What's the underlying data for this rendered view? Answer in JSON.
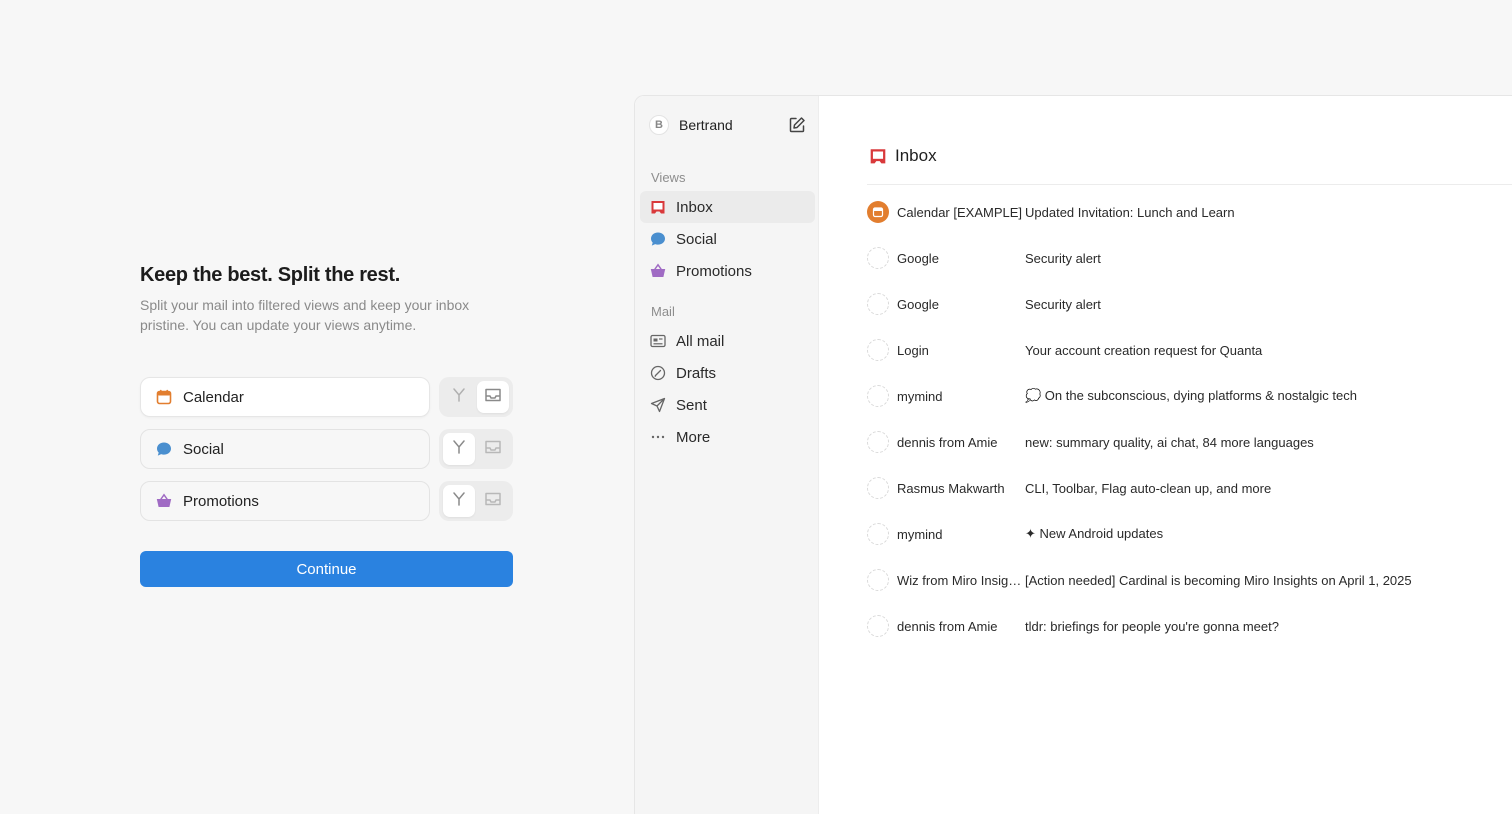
{
  "onboarding": {
    "title": "Keep the best. Split the rest.",
    "subtitle": "Split your mail into filtered views and keep your inbox pristine. You can update your views anytime.",
    "views": [
      {
        "label": "Calendar",
        "icon": "calendar-icon",
        "color": "#e27e2f",
        "mode": "inbox"
      },
      {
        "label": "Social",
        "icon": "chat-bubble-icon",
        "color": "#4a8fcf",
        "mode": "split"
      },
      {
        "label": "Promotions",
        "icon": "basket-icon",
        "color": "#a06bc4",
        "mode": "split"
      }
    ],
    "continue_label": "Continue",
    "accent": "#2a82e0"
  },
  "sidebar": {
    "user_initial": "B",
    "user_name": "Bertrand",
    "views_label": "Views",
    "mail_label": "Mail",
    "views": [
      {
        "label": "Inbox",
        "icon": "inbox-icon"
      },
      {
        "label": "Social",
        "icon": "chat-bubble-icon"
      },
      {
        "label": "Promotions",
        "icon": "basket-icon"
      }
    ],
    "mail": [
      {
        "label": "All mail",
        "icon": "all-mail-icon"
      },
      {
        "label": "Drafts",
        "icon": "drafts-icon"
      },
      {
        "label": "Sent",
        "icon": "sent-icon"
      },
      {
        "label": "More",
        "icon": "more-icon"
      }
    ]
  },
  "main": {
    "title": "Inbox",
    "emails": [
      {
        "sender": "Calendar [EXAMPLE]",
        "subject": "Updated Invitation: Lunch and Learn"
      },
      {
        "sender": "Google",
        "subject": "Security alert"
      },
      {
        "sender": "Google",
        "subject": "Security alert"
      },
      {
        "sender": "Login",
        "subject": "Your account creation request for Quanta"
      },
      {
        "sender": "mymind",
        "subject": "💭 On the subconscious, dying platforms & nostalgic tech"
      },
      {
        "sender": "dennis from Amie",
        "subject": "new: summary quality, ai chat, 84 more languages"
      },
      {
        "sender": "Rasmus Makwarth",
        "subject": "CLI, Toolbar, Flag auto-clean up, and more"
      },
      {
        "sender": "mymind",
        "subject": "✦ New Android updates"
      },
      {
        "sender": "Wiz from Miro Insights",
        "subject": "[Action needed] Cardinal is becoming Miro Insights on April 1, 2025"
      },
      {
        "sender": "dennis from Amie",
        "subject": "tldr: briefings for people you're gonna meet?"
      }
    ]
  }
}
